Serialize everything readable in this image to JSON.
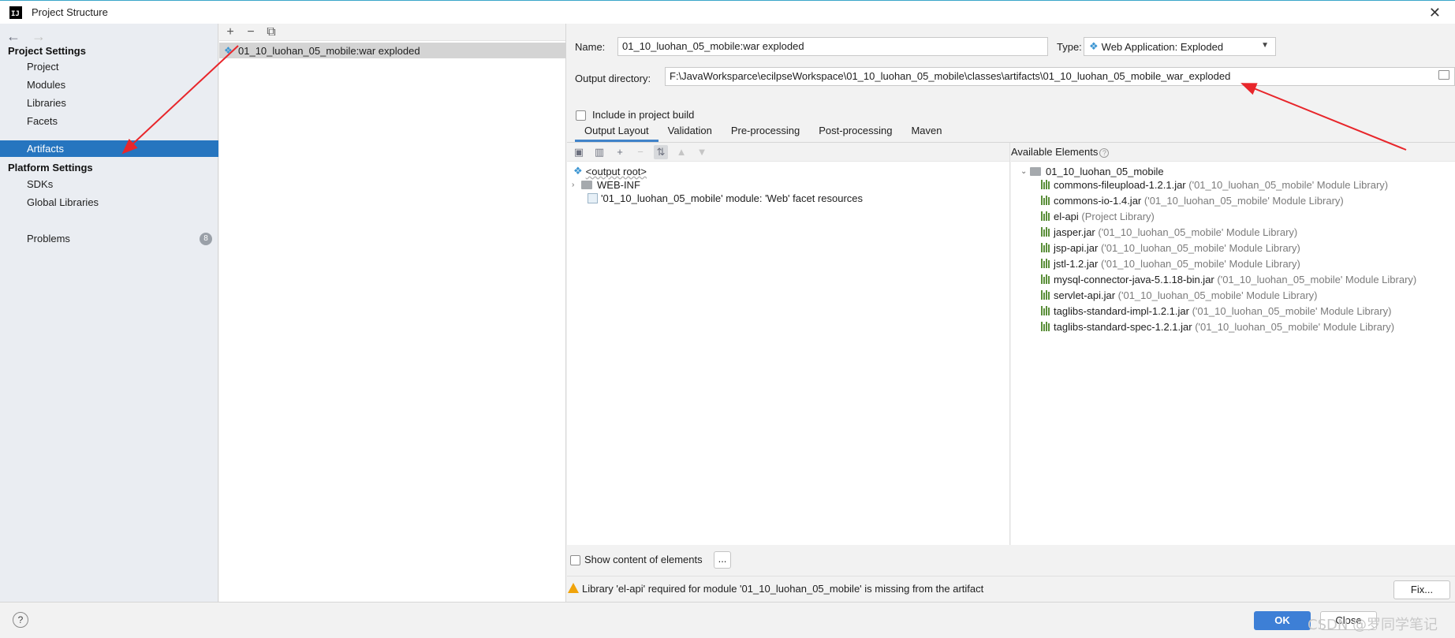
{
  "window": {
    "title": "Project Structure",
    "icon_text": "IJ",
    "close_glyph": "✕"
  },
  "nav": {
    "back_glyph": "←",
    "forward_glyph": "→",
    "project_settings": "Project Settings",
    "project_items": [
      "Project",
      "Modules",
      "Libraries",
      "Facets",
      "Artifacts"
    ],
    "selected": "Artifacts",
    "platform_settings": "Platform Settings",
    "platform_items": [
      "SDKs",
      "Global Libraries"
    ],
    "problems": "Problems",
    "problems_count": "8"
  },
  "artifact_list": {
    "toolbar": [
      "+",
      "−",
      "⧉"
    ],
    "items": [
      "01_10_luohan_05_mobile:war exploded"
    ]
  },
  "form": {
    "name_label": "Name:",
    "name_value": "01_10_luohan_05_mobile:war exploded",
    "type_label": "Type:",
    "type_value": "Web Application: Exploded",
    "output_label": "Output directory:",
    "output_value": "F:\\JavaWorksparce\\ecilpseWorkspace\\01_10_luohan_05_mobile\\classes\\artifacts\\01_10_luohan_05_mobile_war_exploded",
    "include_label": "Include in project build",
    "include_checked": false
  },
  "tabs": [
    "Output Layout",
    "Validation",
    "Pre-processing",
    "Post-processing",
    "Maven"
  ],
  "active_tab": "Output Layout",
  "layout_tree": {
    "root": "<output root>",
    "folder": "WEB-INF",
    "resource": "'01_10_luohan_05_mobile' module: 'Web' facet resources"
  },
  "available": {
    "header": "Available Elements",
    "module": "01_10_luohan_05_mobile",
    "libs": [
      {
        "name": "commons-fileupload-1.2.1.jar",
        "note": "('01_10_luohan_05_mobile' Module Library)"
      },
      {
        "name": "commons-io-1.4.jar",
        "note": "('01_10_luohan_05_mobile' Module Library)"
      },
      {
        "name": "el-api",
        "note": "(Project Library)"
      },
      {
        "name": "jasper.jar",
        "note": "('01_10_luohan_05_mobile' Module Library)"
      },
      {
        "name": "jsp-api.jar",
        "note": "('01_10_luohan_05_mobile' Module Library)"
      },
      {
        "name": "jstl-1.2.jar",
        "note": "('01_10_luohan_05_mobile' Module Library)"
      },
      {
        "name": "mysql-connector-java-5.1.18-bin.jar",
        "note": "('01_10_luohan_05_mobile' Module Library)"
      },
      {
        "name": "servlet-api.jar",
        "note": "('01_10_luohan_05_mobile' Module Library)"
      },
      {
        "name": "taglibs-standard-impl-1.2.1.jar",
        "note": "('01_10_luohan_05_mobile' Module Library)"
      },
      {
        "name": "taglibs-standard-spec-1.2.1.jar",
        "note": "('01_10_luohan_05_mobile' Module Library)"
      }
    ]
  },
  "bottom": {
    "show_content_label": "Show content of elements",
    "dots": "...",
    "warning": "Library 'el-api' required for module '01_10_luohan_05_mobile' is missing from the artifact",
    "fix": "Fix..."
  },
  "footer": {
    "help": "?",
    "ok": "OK",
    "close": "Close",
    "watermark": "CSDN @罗同学笔记"
  },
  "colors": {
    "selection": "#2675bf",
    "ok_button": "#3d7fd6",
    "annotation_arrow": "#e8262b",
    "warning": "#f0a30a"
  }
}
